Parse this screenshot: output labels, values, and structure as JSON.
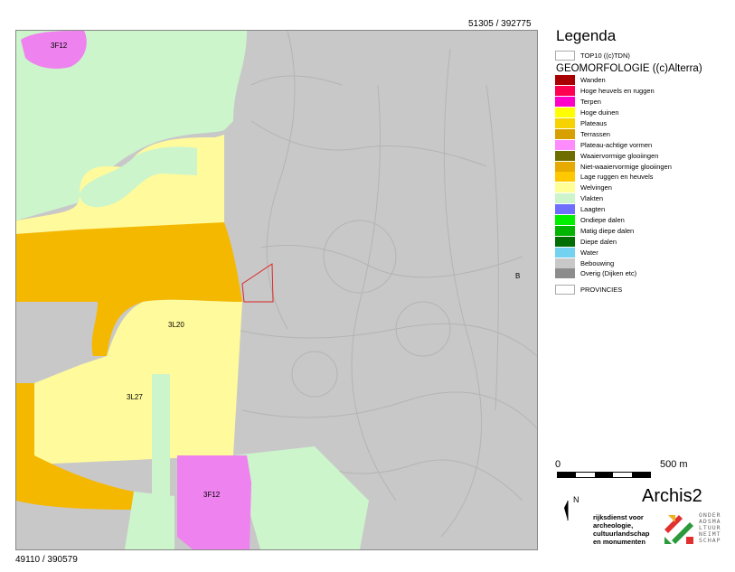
{
  "coords": {
    "top_right": "51305 / 392775",
    "bottom_left": "49110 / 390579"
  },
  "map": {
    "labels": [
      "3F12",
      "3L20",
      "3L27",
      "3F12",
      "B"
    ],
    "colors": {
      "built": "#c8c8c8",
      "plain": "#ccf5cc",
      "low_ridges": "#fffa9b",
      "slope": "#f5b800",
      "plateau_like": "#ee82ee",
      "province_outline": "#dd2222"
    }
  },
  "legend": {
    "title": "Legenda",
    "top10": {
      "label": "TOP10 ((c)TDN)",
      "color": "#ffffff"
    },
    "geo_title": "GEOMORFOLOGIE ((c)Alterra)",
    "items": [
      {
        "label": "Wanden",
        "color": "#a80000"
      },
      {
        "label": "Hoge heuvels en ruggen",
        "color": "#ff0050"
      },
      {
        "label": "Terpen",
        "color": "#ff00c8"
      },
      {
        "label": "Hoge duinen",
        "color": "#ffff00"
      },
      {
        "label": "Plateaus",
        "color": "#f5d200"
      },
      {
        "label": "Terrassen",
        "color": "#d7a000"
      },
      {
        "label": "Plateau-achtige vormen",
        "color": "#ff8cff"
      },
      {
        "label": "Waaiervormige glooiingen",
        "color": "#6e6e00"
      },
      {
        "label": "Niet-waaiervormige glooiingen",
        "color": "#e6aa00"
      },
      {
        "label": "Lage ruggen en heuvels",
        "color": "#ffc800"
      },
      {
        "label": "Welvingen",
        "color": "#ffff96"
      },
      {
        "label": "Vlakten",
        "color": "#ccf5cc"
      },
      {
        "label": "Laagten",
        "color": "#6e6eff"
      },
      {
        "label": "Ondiepe dalen",
        "color": "#00f000"
      },
      {
        "label": "Matig diepe dalen",
        "color": "#00b400"
      },
      {
        "label": "Diepe dalen",
        "color": "#006e00"
      },
      {
        "label": "Water",
        "color": "#73d2f0"
      },
      {
        "label": "Bebouwing",
        "color": "#c8c8c8"
      },
      {
        "label": "Overig (Dijken etc)",
        "color": "#8c8c8c"
      }
    ],
    "provinces": {
      "label": "PROVINCIES",
      "color": "#ffffff"
    }
  },
  "scale": {
    "start": "0",
    "end": "500 m"
  },
  "north": "N",
  "app_title": "Archis2",
  "organization": [
    "rijksdienst voor",
    "archeologie,",
    "cultuurlandschap",
    "en monumenten"
  ],
  "org_side": [
    "ONDER",
    "ADSMA",
    "LTUUR",
    "NEIMT",
    "SCHAP"
  ]
}
